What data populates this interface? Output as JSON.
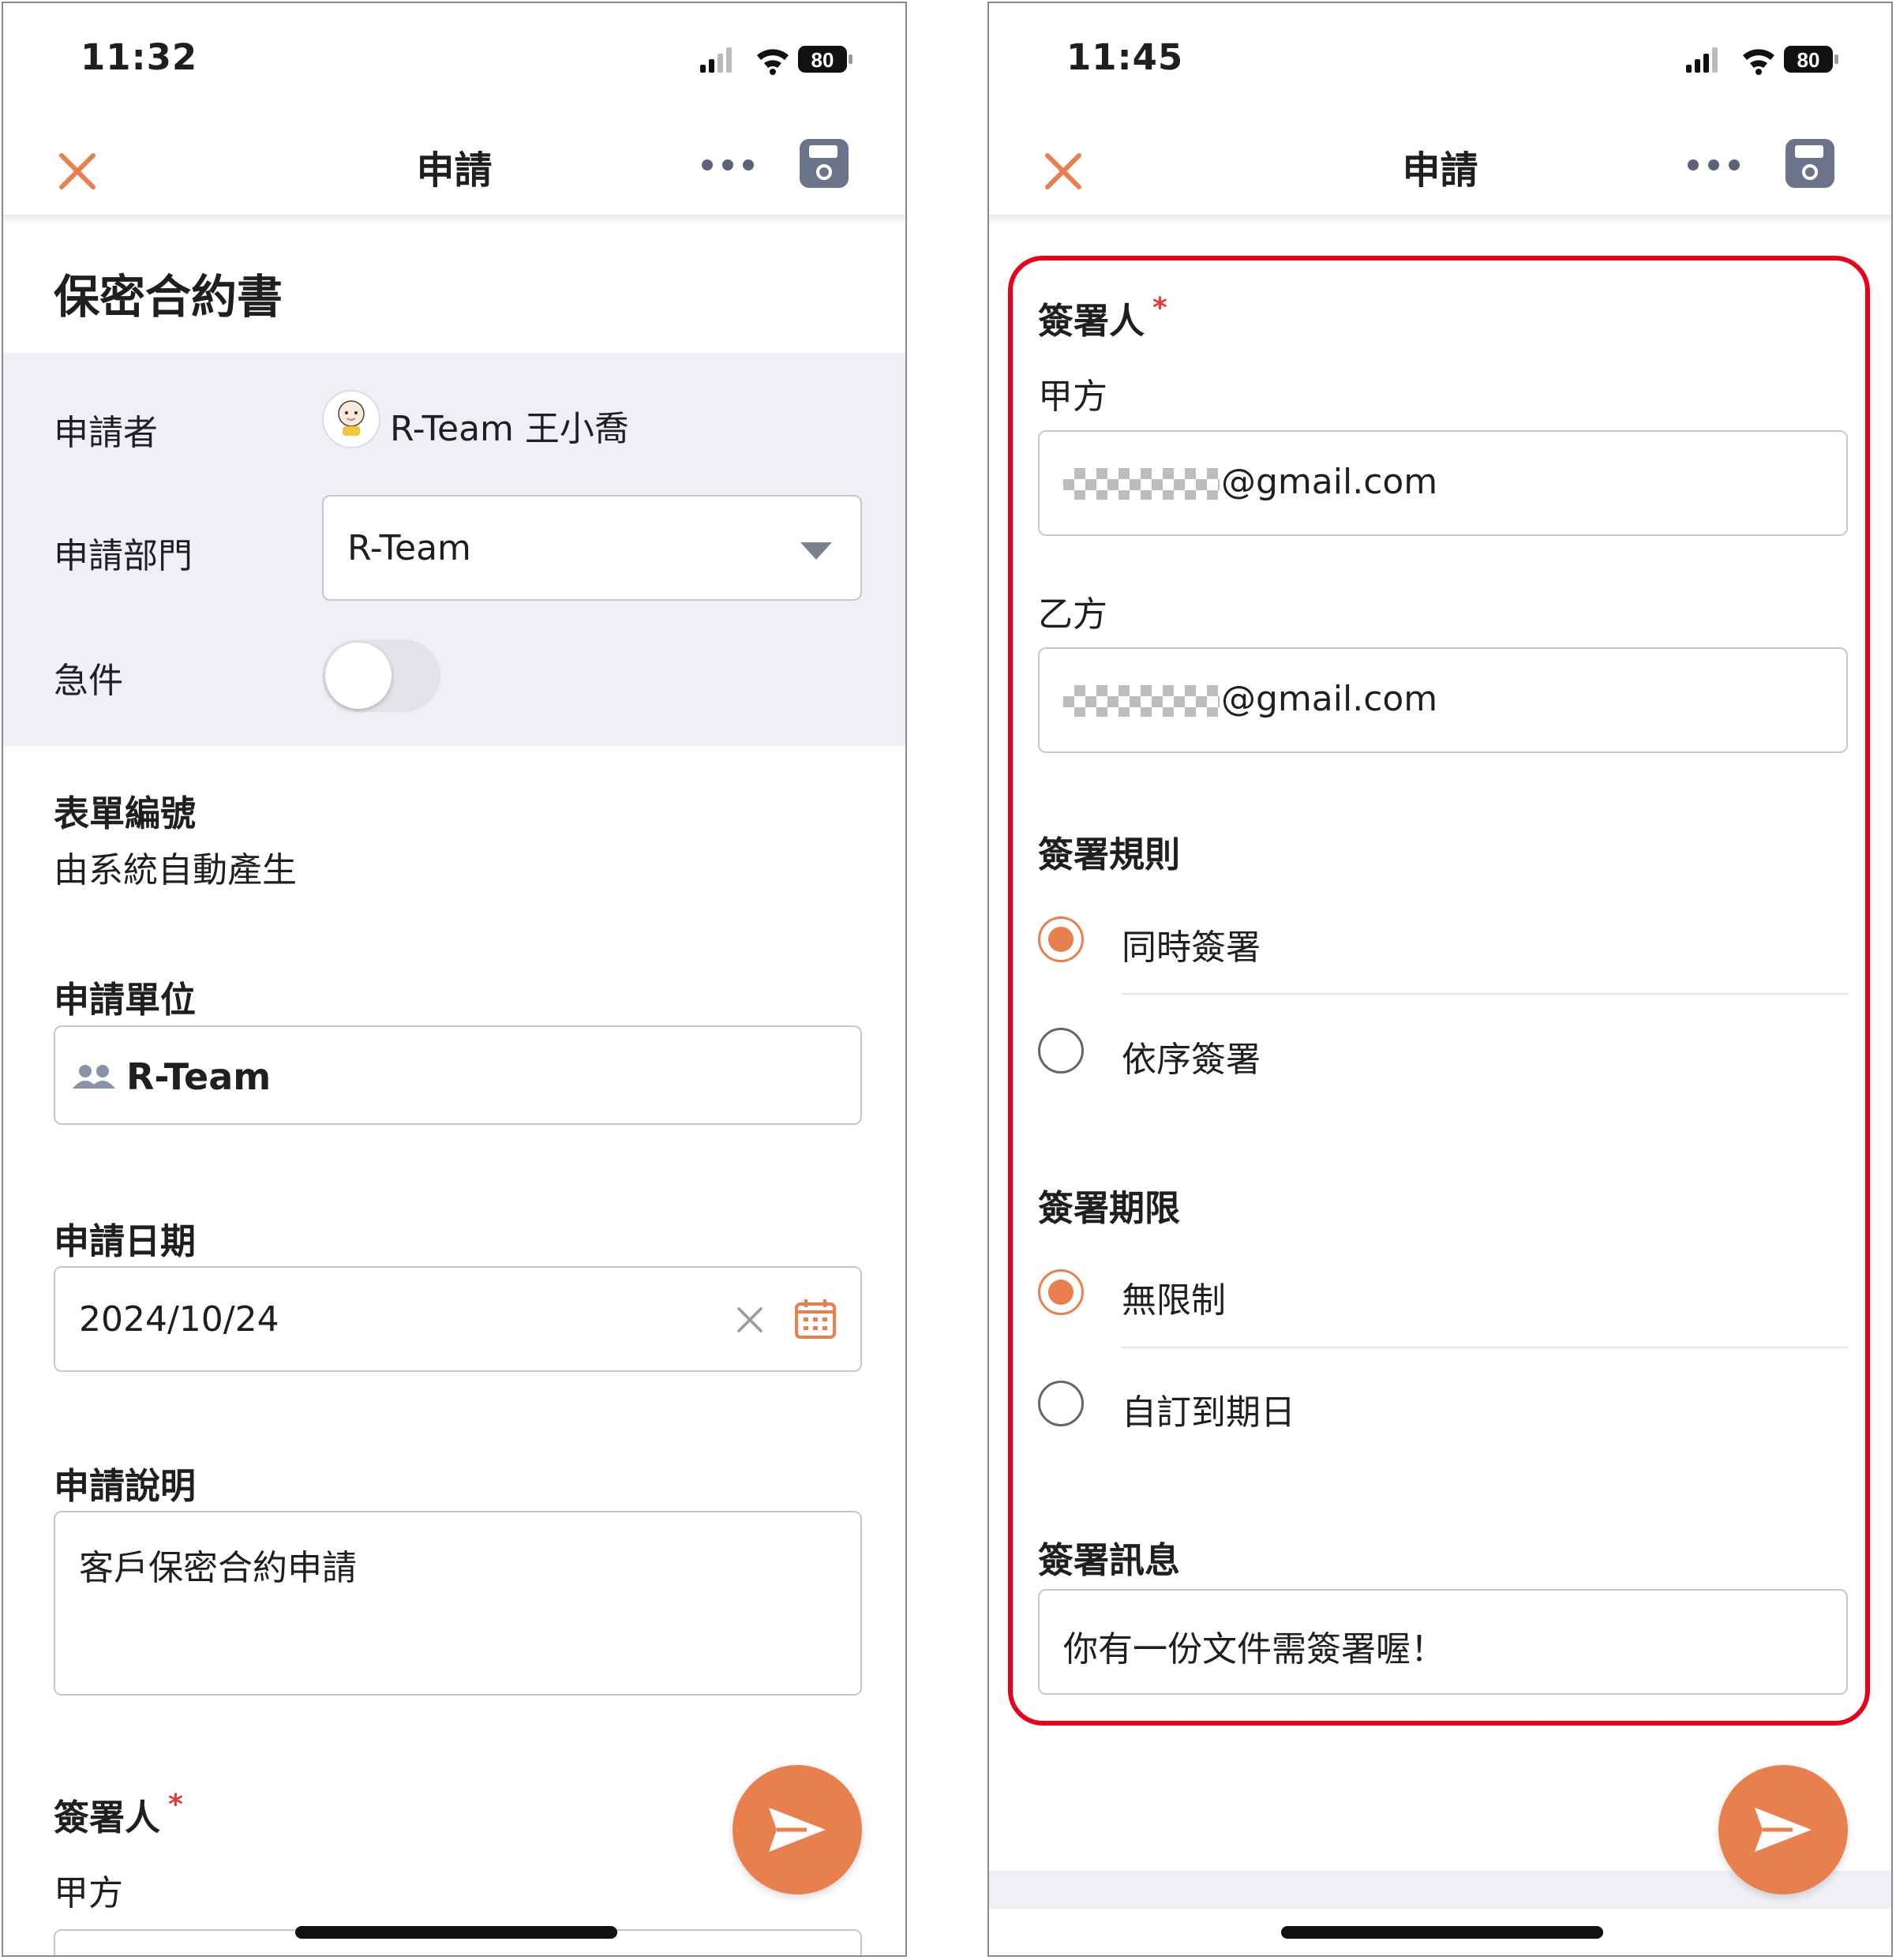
{
  "left": {
    "status": {
      "time": "11:32",
      "battery": "80"
    },
    "nav": {
      "title": "申請"
    },
    "doc_title": "保密合約書",
    "applicant": {
      "label": "申請者",
      "name": "R-Team  王小喬"
    },
    "department": {
      "label": "申請部門",
      "value": "R-Team"
    },
    "urgent": {
      "label": "急件",
      "on": false
    },
    "form_no": {
      "label": "表單編號",
      "value": "由系統自動產生"
    },
    "unit": {
      "label": "申請單位",
      "value": "R-Team"
    },
    "date": {
      "label": "申請日期",
      "value": "2024/10/24"
    },
    "description": {
      "label": "申請說明",
      "value": "客戶保密合約申請"
    },
    "signer": {
      "label": "簽署人",
      "required": "*",
      "party_a": "甲方"
    }
  },
  "right": {
    "status": {
      "time": "11:45",
      "battery": "80"
    },
    "nav": {
      "title": "申請"
    },
    "signer": {
      "label": "簽署人",
      "required": "*"
    },
    "party_a": {
      "label": "甲方",
      "email_suffix": "@gmail.com"
    },
    "party_b": {
      "label": "乙方",
      "email_suffix": "@gmail.com"
    },
    "rule": {
      "label": "簽署規則",
      "options": [
        {
          "label": "同時簽署",
          "selected": true
        },
        {
          "label": "依序簽署",
          "selected": false
        }
      ]
    },
    "deadline": {
      "label": "簽署期限",
      "options": [
        {
          "label": "無限制",
          "selected": true
        },
        {
          "label": "自訂到期日",
          "selected": false
        }
      ]
    },
    "message": {
      "label": "簽署訊息",
      "value": "你有一份文件需簽署喔！"
    }
  },
  "colors": {
    "accent": "#e8804e",
    "highlight_frame": "#e8001b",
    "panel": "#eef0f5"
  },
  "icons": [
    "close-icon",
    "more-icon",
    "save-icon",
    "avatar",
    "chevron-down-icon",
    "people-icon",
    "clear-icon",
    "calendar-icon",
    "send-icon",
    "signal-icon",
    "wifi-icon",
    "battery-icon"
  ]
}
